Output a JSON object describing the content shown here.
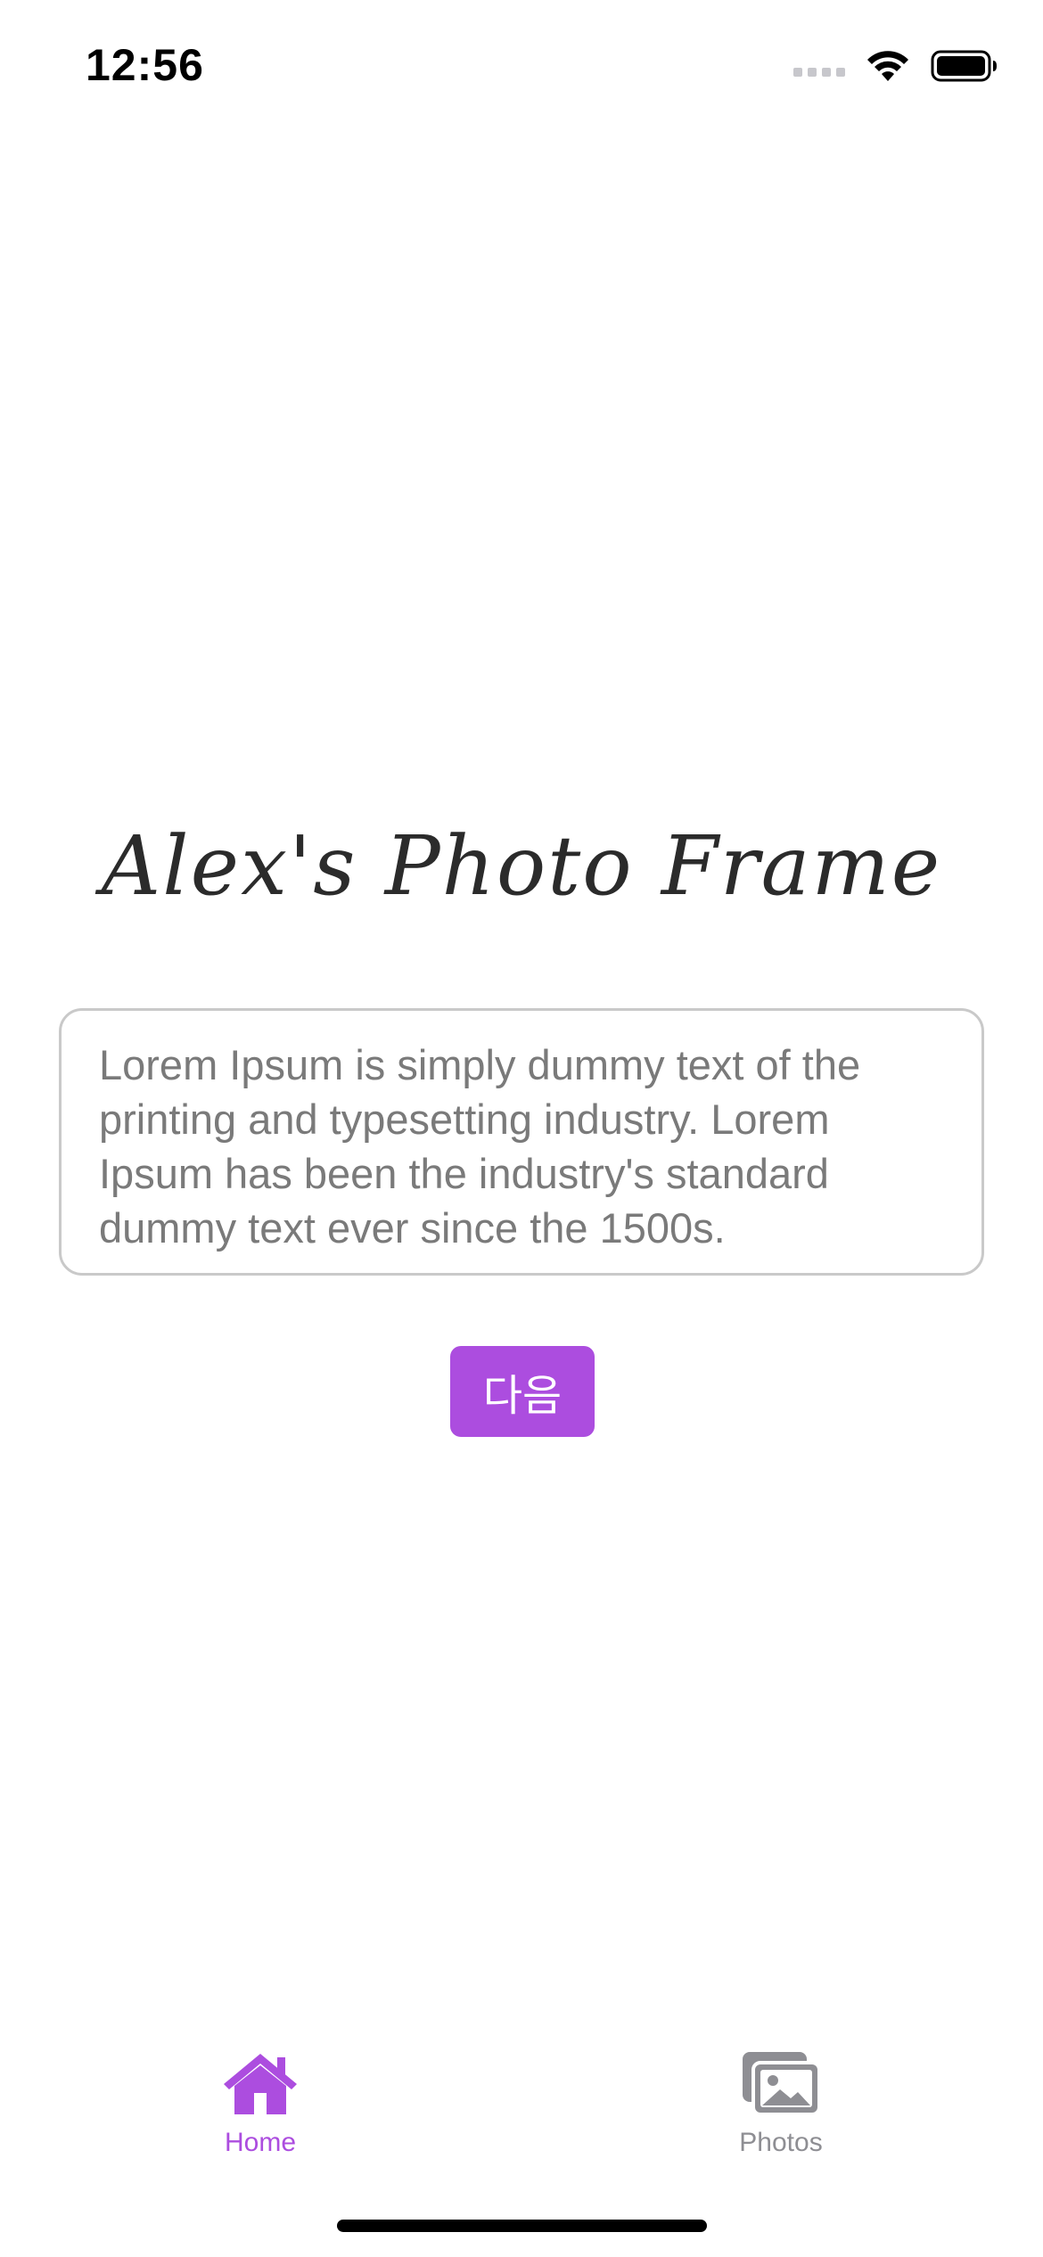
{
  "status_bar": {
    "time": "12:56",
    "icons": [
      "cellular-icon",
      "wifi-icon",
      "battery-icon"
    ]
  },
  "main": {
    "title": "Alex's Photo Frame",
    "text_box_content": "Lorem Ipsum is simply dummy text of the printing and typesetting industry. Lorem Ipsum has been the industry's standard dummy text ever since the 1500s.",
    "next_button_label": "다음"
  },
  "tab_bar": {
    "tabs": [
      {
        "label": "Home",
        "icon": "home-icon",
        "selected": true
      },
      {
        "label": "Photos",
        "icon": "photos-icon",
        "selected": false
      }
    ]
  },
  "colors": {
    "accent": "#ac4ddf",
    "inactive_tab": "#8e8e93",
    "text_box_border": "#c9c9c9",
    "text_box_text": "#7a7a7a"
  }
}
